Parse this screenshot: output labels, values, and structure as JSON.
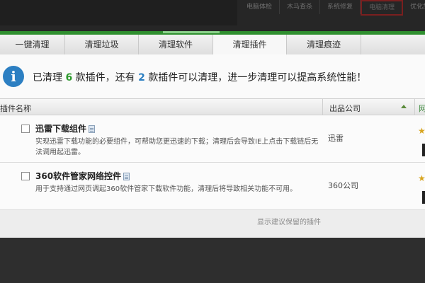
{
  "background_menu": {
    "items": [
      {
        "label": "电脑体检"
      },
      {
        "label": "木马查杀"
      },
      {
        "label": "系统修复"
      },
      {
        "label": "电脑清理",
        "active": true
      },
      {
        "label": "优化加速"
      }
    ]
  },
  "tabs": [
    {
      "label": "一键清理"
    },
    {
      "label": "清理垃圾"
    },
    {
      "label": "清理软件"
    },
    {
      "label": "清理插件",
      "active": true
    },
    {
      "label": "清理痕迹"
    }
  ],
  "info": {
    "icon": "info-icon",
    "prefix": "已清理",
    "cleaned_count": "6",
    "middle": "款插件，还有",
    "remaining_count": "2",
    "suffix": "款插件可以清理，进一步清理可以提高系统性能！"
  },
  "table": {
    "headers": {
      "name": "插件名称",
      "company": "出品公司",
      "extra": "网"
    },
    "rows": [
      {
        "name": "迅雷下载组件",
        "description": "实现迅雷下载功能的必要组件，可帮助您更迅速的下载；清理后会导致IE上点击下载链后无法调用起迅雷。",
        "company": "迅雷"
      },
      {
        "name": "360软件管家网络控件",
        "description": "用于支持通过网页调起360软件管家下载软件功能，清理后将导致相关功能不可用。",
        "company": "360公司"
      }
    ]
  },
  "footer": {
    "link": "显示建议保留的插件"
  },
  "colors": {
    "accent_green": "#2f8f2f",
    "info_blue": "#2c7fc2"
  }
}
